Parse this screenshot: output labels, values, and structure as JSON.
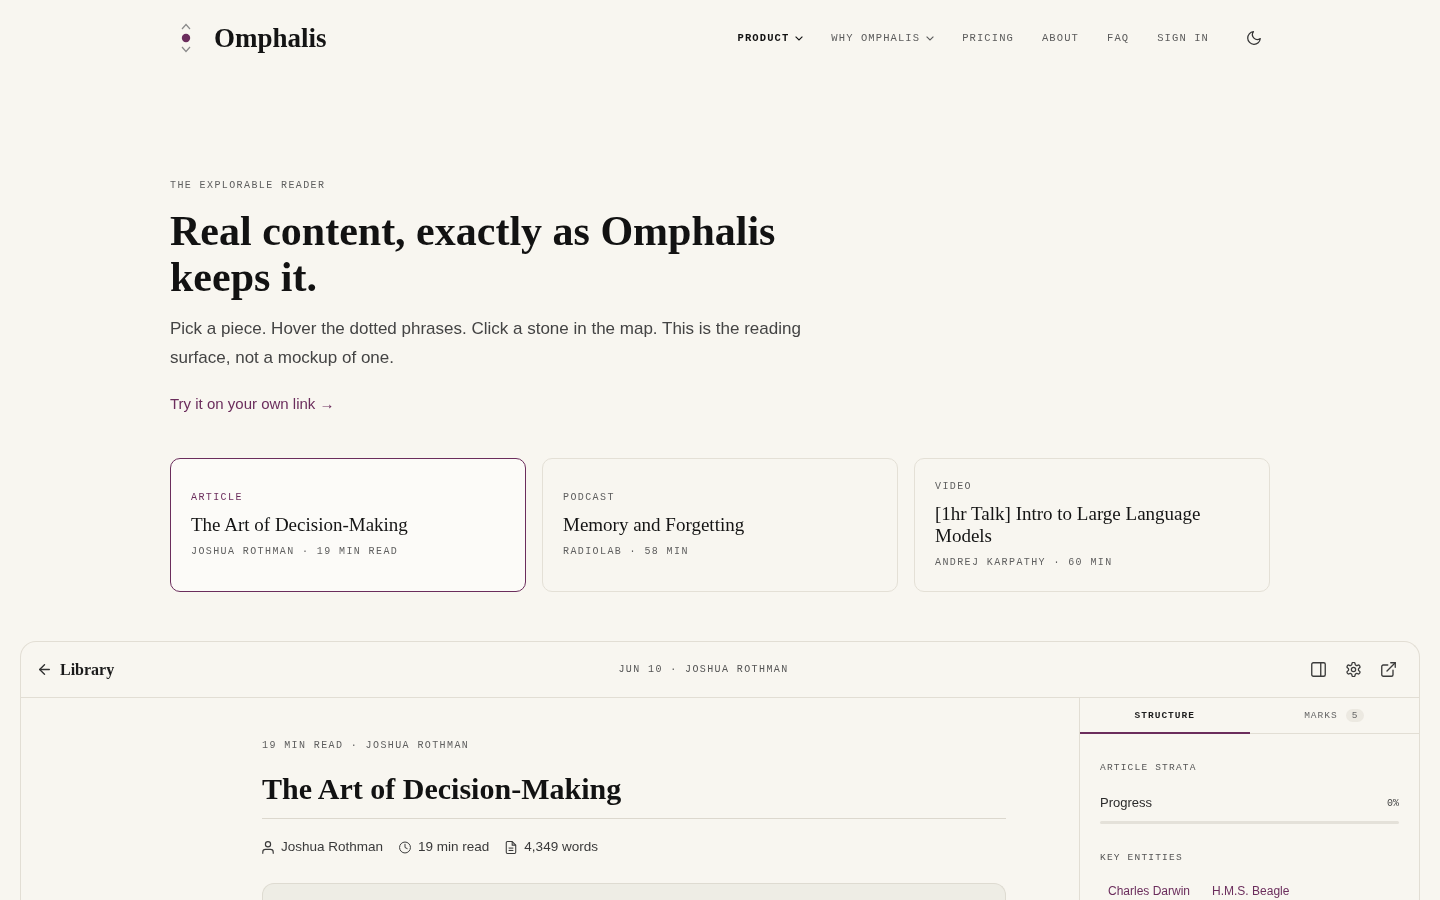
{
  "header": {
    "logo_text": "Omphalis",
    "nav": [
      {
        "label": "PRODUCT",
        "kind": "menu",
        "selected": true
      },
      {
        "label": "WHY OMPHALIS",
        "kind": "menu",
        "selected": false
      },
      {
        "label": "PRICING",
        "kind": "link",
        "selected": false
      },
      {
        "label": "ABOUT",
        "kind": "link",
        "selected": false
      },
      {
        "label": "FAQ",
        "kind": "link",
        "selected": false
      },
      {
        "label": "SIGN IN",
        "kind": "link",
        "selected": false
      }
    ]
  },
  "hero": {
    "eyebrow": "THE EXPLORABLE READER",
    "title": "Real content, exactly as Omphalis keeps it.",
    "intro": "Pick a piece. Hover the dotted phrases. Click a stone in the map. This is the reading surface, not a mockup of one.",
    "link": "Try it on your own link →"
  },
  "samples": [
    {
      "kind_label": "ARTICLE",
      "title": "The Art of Decision-Making",
      "meta": "JOSHUA ROTHMAN · 19 MIN READ",
      "selected": true
    },
    {
      "kind_label": "PODCAST",
      "title": "Memory and Forgetting",
      "meta": "RADIOLAB · 58 MIN",
      "selected": false
    },
    {
      "kind_label": "VIDEO",
      "title": "[1hr Talk] Intro to Large Language Models",
      "meta": "ANDREJ KARPATHY · 60 MIN",
      "selected": false
    }
  ],
  "reader": {
    "back_label": "Library",
    "header_meta": "JUN 10 · JOSHUA ROTHMAN",
    "article": {
      "meta": "19 MIN READ · JOSHUA ROTHMAN",
      "title": "The Art of Decision-Making",
      "byline": [
        {
          "kind": "author",
          "text": "Joshua Rothman"
        },
        {
          "kind": "time",
          "text": "19 min read"
        },
        {
          "kind": "words",
          "text": "4,349 words"
        }
      ]
    },
    "sidebar": {
      "tabs": [
        {
          "label": "STRUCTURE",
          "selected": true
        },
        {
          "label": "MARKS",
          "count": "5",
          "selected": false
        }
      ],
      "strata": {
        "heading": "ARTICLE STRATA",
        "progress_label": "Progress",
        "reading": "0%",
        "level": 0
      },
      "entities": {
        "heading": "KEY ENTITIES",
        "items": [
          "Charles Darwin",
          "H.M.S. Beagle"
        ]
      }
    }
  }
}
